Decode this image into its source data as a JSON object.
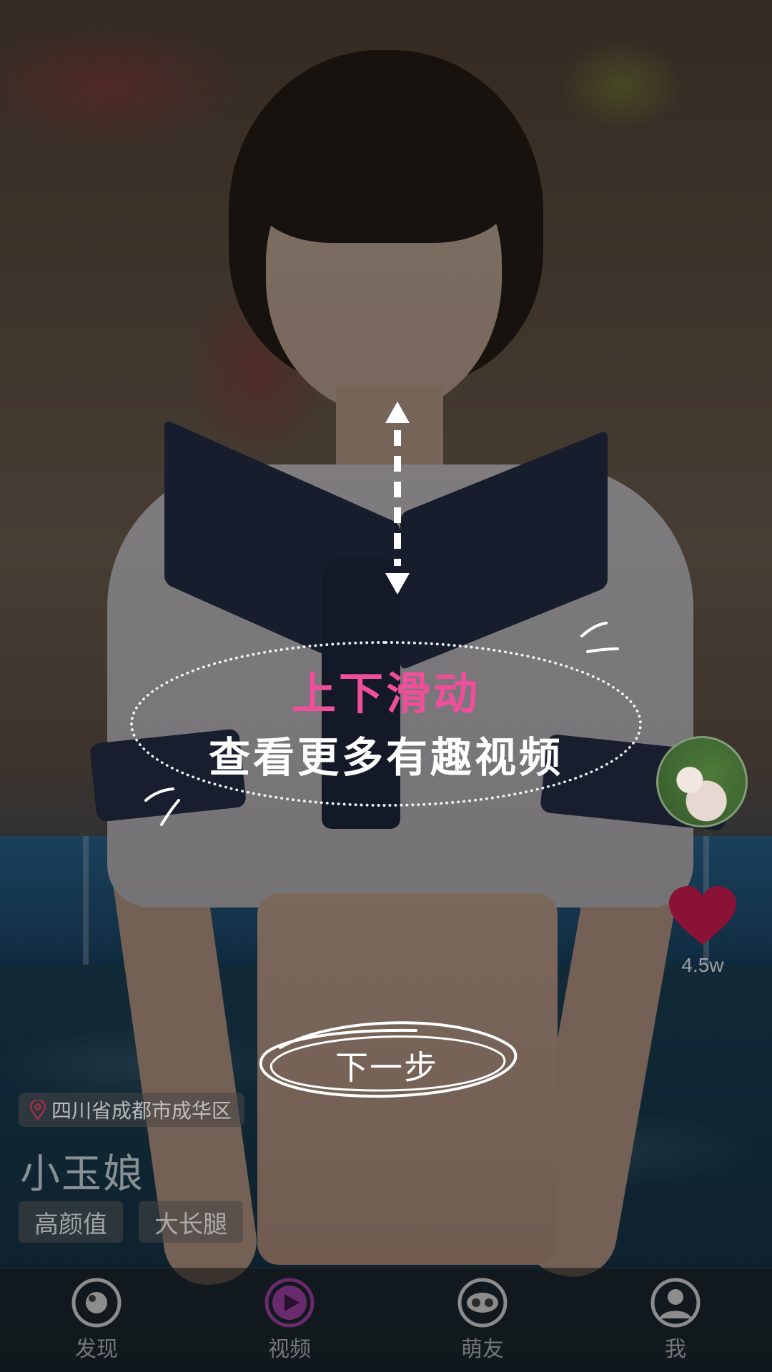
{
  "guide": {
    "title": "上下滑动",
    "subtitle": "查看更多有趣视频",
    "next_button": "下一步"
  },
  "video": {
    "location": "四川省成都市成华区",
    "username": "小玉娘",
    "tags": [
      "高颜值",
      "大长腿"
    ],
    "like_count": "4.5w"
  },
  "nav": {
    "items": [
      {
        "label": "发现",
        "icon": "discover-icon"
      },
      {
        "label": "视频",
        "icon": "video-play-icon",
        "active": true
      },
      {
        "label": "萌友",
        "icon": "friends-icon"
      },
      {
        "label": "我",
        "icon": "profile-icon"
      }
    ]
  },
  "colors": {
    "accent_pink": "#ef4f9a",
    "like_heart": "#8a1237",
    "nav_active": "#6a2a6e"
  }
}
